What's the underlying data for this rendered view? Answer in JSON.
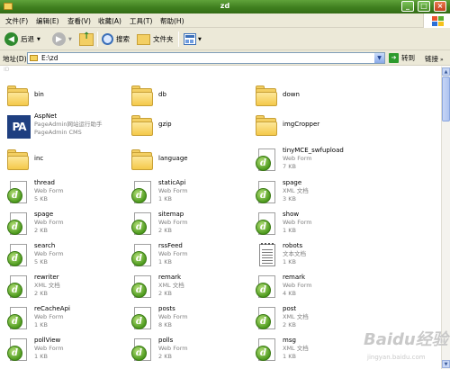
{
  "window": {
    "title": "zd"
  },
  "menu": [
    "文件(F)",
    "编辑(E)",
    "查看(V)",
    "收藏(A)",
    "工具(T)",
    "帮助(H)"
  ],
  "toolbar": {
    "back_label": "后退",
    "search_label": "搜索",
    "folders_label": "文件夹"
  },
  "address": {
    "label": "地址(D)",
    "value": "E:\\zd",
    "go_label": "转到",
    "links_label": "链接"
  },
  "files": [
    {
      "name": "bin",
      "type": "folder"
    },
    {
      "name": "db",
      "type": "folder"
    },
    {
      "name": "down",
      "type": "folder"
    },
    {
      "name": "AspNet",
      "type": "app",
      "line2": "PageAdmin网站运行助手",
      "line3": "PageAdmin CMS"
    },
    {
      "name": "gzip",
      "type": "folder"
    },
    {
      "name": "imgCropper",
      "type": "folder"
    },
    {
      "name": "inc",
      "type": "folder"
    },
    {
      "name": "language",
      "type": "folder"
    },
    {
      "name": "tinyMCE_swfupload",
      "type": "dw",
      "line2": "Web Form",
      "line3": "7 KB"
    },
    {
      "name": "thread",
      "type": "dw",
      "line2": "Web Form",
      "line3": "5 KB"
    },
    {
      "name": "staticApi",
      "type": "dw",
      "line2": "Web Form",
      "line3": "1 KB"
    },
    {
      "name": "spage",
      "type": "dw",
      "line2": "XML 文档",
      "line3": "3 KB"
    },
    {
      "name": "spage",
      "type": "dw",
      "line2": "Web Form",
      "line3": "2 KB"
    },
    {
      "name": "sitemap",
      "type": "dw",
      "line2": "Web Form",
      "line3": "2 KB"
    },
    {
      "name": "show",
      "type": "dw",
      "line2": "Web Form",
      "line3": "1 KB"
    },
    {
      "name": "search",
      "type": "dw",
      "line2": "Web Form",
      "line3": "5 KB"
    },
    {
      "name": "rssFeed",
      "type": "dw",
      "line2": "Web Form",
      "line3": "1 KB"
    },
    {
      "name": "robots",
      "type": "txt",
      "line2": "文本文档",
      "line3": "1 KB"
    },
    {
      "name": "rewriter",
      "type": "dw",
      "line2": "XML 文档",
      "line3": "2 KB"
    },
    {
      "name": "remark",
      "type": "dw",
      "line2": "XML 文档",
      "line3": "2 KB"
    },
    {
      "name": "remark",
      "type": "dw",
      "line2": "Web Form",
      "line3": "4 KB"
    },
    {
      "name": "reCacheApi",
      "type": "dw",
      "line2": "Web Form",
      "line3": "1 KB"
    },
    {
      "name": "posts",
      "type": "dw",
      "line2": "Web Form",
      "line3": "8 KB"
    },
    {
      "name": "post",
      "type": "dw",
      "line2": "XML 文档",
      "line3": "2 KB"
    },
    {
      "name": "pollView",
      "type": "dw",
      "line2": "Web Form",
      "line3": "1 KB"
    },
    {
      "name": "polls",
      "type": "dw",
      "line2": "Web Form",
      "line3": "2 KB"
    },
    {
      "name": "msg",
      "type": "dw",
      "line2": "XML 文档",
      "line3": "1 KB"
    }
  ],
  "faint_text": "ID",
  "watermark": {
    "brand": "Baidu经验",
    "url": "jingyan.baidu.com"
  }
}
